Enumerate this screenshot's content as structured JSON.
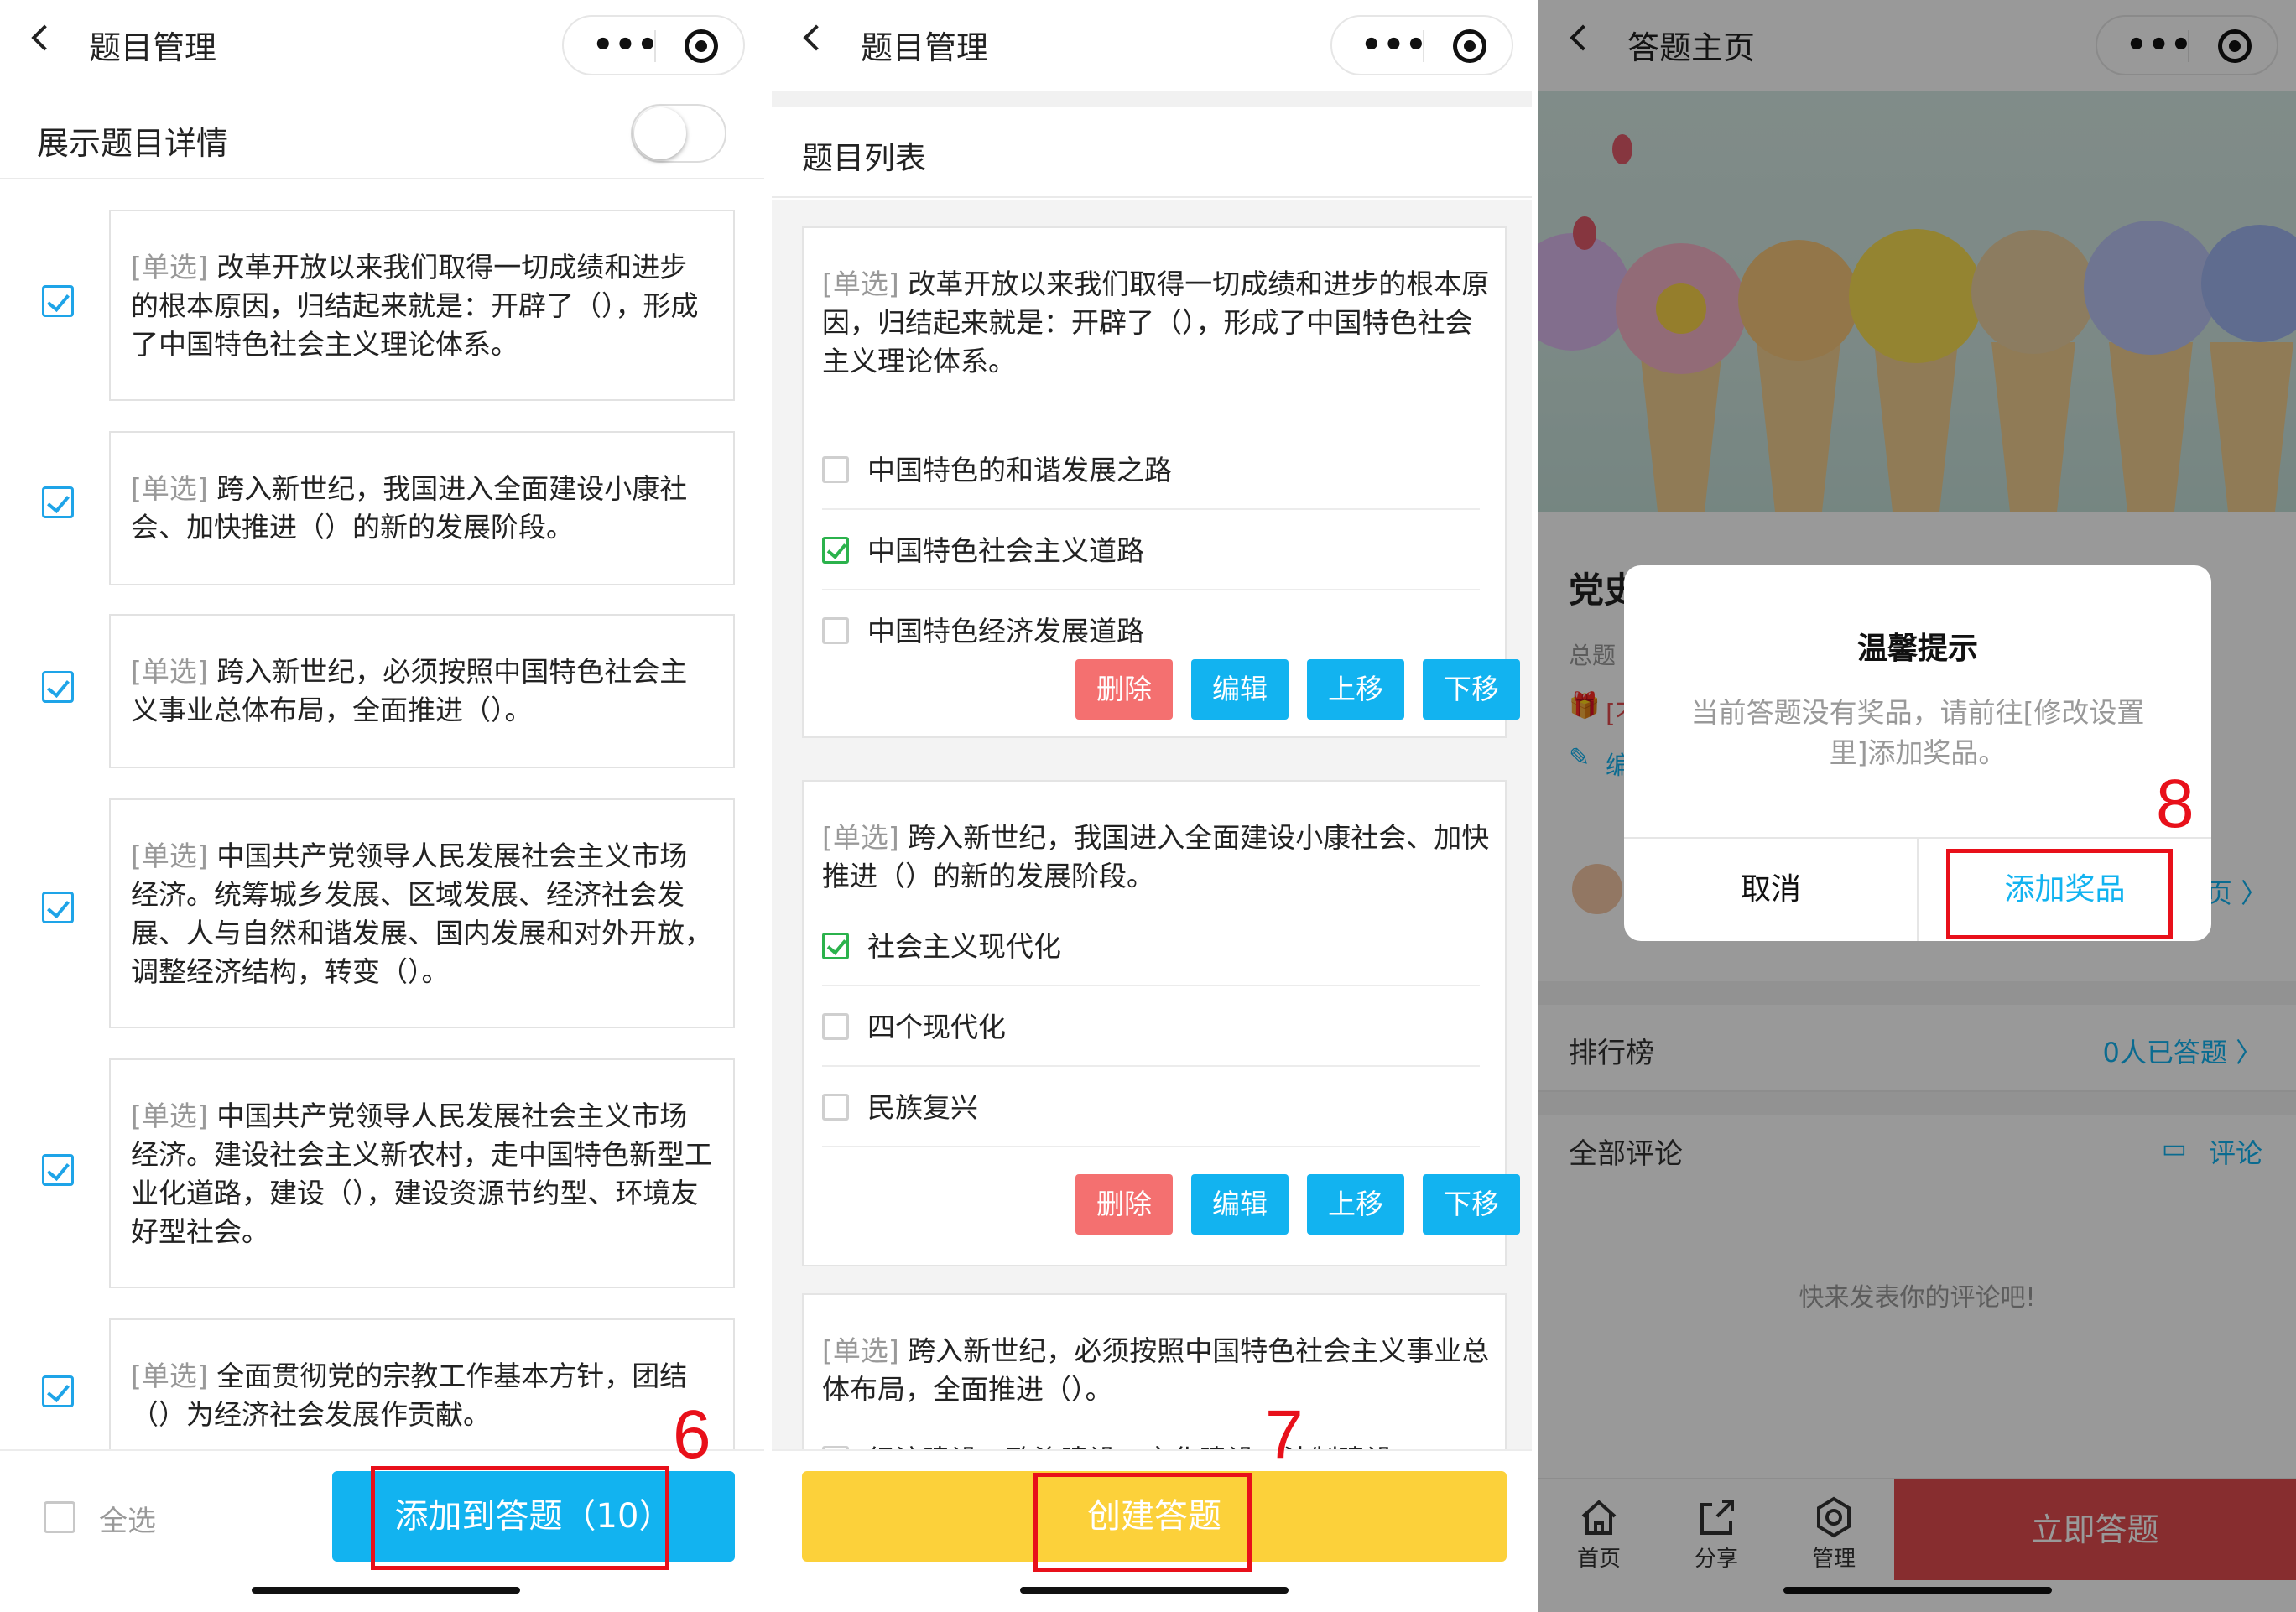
{
  "panel1": {
    "title": "题目管理",
    "toggle_label": "展示题目详情",
    "questions": [
      {
        "tag": "[单选]",
        "text": "改革开放以来我们取得一切成绩和进步的根本原因，归结起来就是：开辟了（），形成了中国特色社会主义理论体系。"
      },
      {
        "tag": "[单选]",
        "text": "跨入新世纪，我国进入全面建设小康社会、加快推进（）的新的发展阶段。"
      },
      {
        "tag": "[单选]",
        "text": "跨入新世纪，必须按照中国特色社会主义事业总体布局，全面推进（）。"
      },
      {
        "tag": "[单选]",
        "text": "中国共产党领导人民发展社会主义市场经济。统筹城乡发展、区域发展、经济社会发展、人与自然和谐发展、国内发展和对外开放，调整经济结构，转变（）。"
      },
      {
        "tag": "[单选]",
        "text": "中国共产党领导人民发展社会主义市场经济。建设社会主义新农村，走中国特色新型工业化道路，建设（），建设资源节约型、环境友好型社会。"
      },
      {
        "tag": "[单选]",
        "text": "全面贯彻党的宗教工作基本方针，团结（）为经济社会发展作贡献。"
      }
    ],
    "select_all": "全选",
    "add_button": "添加到答题（10）",
    "step": "6"
  },
  "panel2": {
    "title": "题目管理",
    "list_title": "题目列表",
    "questions": [
      {
        "tag": "[单选]",
        "text": "改革开放以来我们取得一切成绩和进步的根本原因，归结起来就是：开辟了（），形成了中国特色社会主义理论体系。",
        "options": [
          "中国特色的和谐发展之路",
          "中国特色社会主义道路",
          "中国特色经济发展道路"
        ],
        "checked": 1
      },
      {
        "tag": "[单选]",
        "text": "跨入新世纪，我国进入全面建设小康社会、加快推进（）的新的发展阶段。",
        "options": [
          "社会主义现代化",
          "四个现代化",
          "民族复兴"
        ],
        "checked": 0
      },
      {
        "tag": "[单选]",
        "text": "跨入新世纪，必须按照中国特色社会主义事业总体布局，全面推进（）。",
        "options": [
          "经济建设、政治建设、文化建设、法制建设"
        ],
        "checked": -1
      }
    ],
    "actions": {
      "delete": "删除",
      "edit": "编辑",
      "up": "上移",
      "down": "下移"
    },
    "create_button": "创建答题",
    "step": "7"
  },
  "panel3": {
    "title": "答题主页",
    "behind": {
      "title_frag": "党史",
      "total_frag": "总题",
      "prize_frag": "[不",
      "edit_frag": "编",
      "home_frag": "页 〉"
    },
    "ranking": {
      "label": "排行榜",
      "value": "0人已答题 〉"
    },
    "comments": {
      "label": "全部评论",
      "action": "评论",
      "empty": "快来发表你的评论吧!"
    },
    "tabs": [
      "首页",
      "分享",
      "管理"
    ],
    "start_button": "立即答题",
    "modal": {
      "title": "温馨提示",
      "body": "当前答题没有奖品，请前往[修改设置里]添加奖品。",
      "cancel": "取消",
      "confirm": "添加奖品"
    },
    "step": "8"
  },
  "colors": {
    "accent_blue": "#12b3f0",
    "delete_red": "#f47070",
    "create_yellow": "#fcd13a",
    "start_red": "#e24b4f",
    "highlight": "#e8101a",
    "check_green": "#2bb24c"
  }
}
